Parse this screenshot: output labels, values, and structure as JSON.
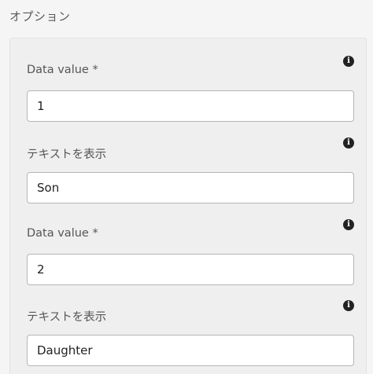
{
  "section_title": "オプション",
  "options": [
    {
      "data_value_label": "Data value *",
      "data_value": "1",
      "display_text_label": "テキストを表示",
      "display_text": "Son"
    },
    {
      "data_value_label": "Data value *",
      "data_value": "2",
      "display_text_label": "テキストを表示",
      "display_text": "Daughter"
    }
  ],
  "icons": {
    "info": "info-icon"
  },
  "info_icon_glyph": "i"
}
